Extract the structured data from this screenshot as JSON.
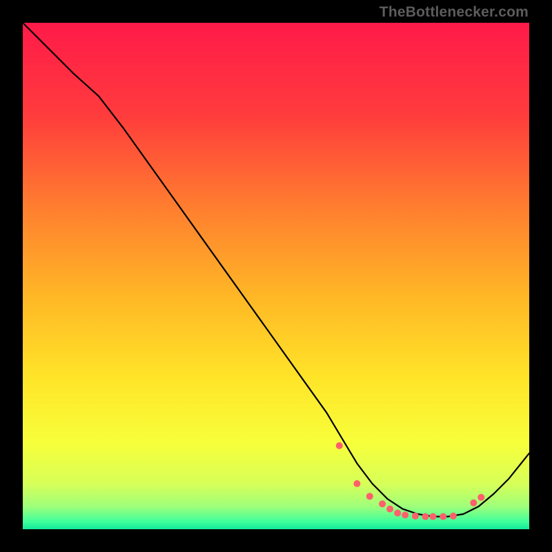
{
  "watermark": "TheBottlenecker.com",
  "gradient": {
    "stops": [
      {
        "offset": 0.0,
        "color": "#ff1a49"
      },
      {
        "offset": 0.18,
        "color": "#ff3b3d"
      },
      {
        "offset": 0.36,
        "color": "#ff7c2f"
      },
      {
        "offset": 0.54,
        "color": "#ffb726"
      },
      {
        "offset": 0.7,
        "color": "#ffe428"
      },
      {
        "offset": 0.83,
        "color": "#f7ff3a"
      },
      {
        "offset": 0.91,
        "color": "#d7ff58"
      },
      {
        "offset": 0.955,
        "color": "#9fff7a"
      },
      {
        "offset": 0.985,
        "color": "#3fff9b"
      },
      {
        "offset": 1.0,
        "color": "#12e89a"
      }
    ]
  },
  "chart_data": {
    "type": "line",
    "title": "",
    "xlabel": "",
    "ylabel": "",
    "xlim": [
      0,
      100
    ],
    "ylim": [
      0,
      100
    ],
    "series": [
      {
        "name": "curve",
        "x": [
          0,
          5,
          10,
          15,
          20,
          25,
          30,
          35,
          40,
          45,
          50,
          55,
          60,
          63,
          66,
          69,
          72,
          75,
          78,
          81,
          84,
          87,
          90,
          93,
          96,
          100
        ],
        "values": [
          100,
          95,
          90,
          85.5,
          79,
          72,
          65,
          58,
          51,
          44,
          37,
          30,
          23,
          18,
          13,
          9,
          6,
          4,
          3,
          2.5,
          2.5,
          3,
          4.5,
          7,
          10,
          15
        ]
      }
    ],
    "markers": {
      "name": "dots",
      "color": "#ff5f6b",
      "radius": 5,
      "x": [
        62.5,
        66,
        68.5,
        71,
        72.5,
        74,
        75.5,
        77.5,
        79.5,
        81,
        83,
        85,
        89,
        90.5
      ],
      "values": [
        16.5,
        9,
        6.5,
        5,
        4,
        3.2,
        2.8,
        2.6,
        2.5,
        2.5,
        2.5,
        2.6,
        5.2,
        6.3
      ]
    }
  }
}
